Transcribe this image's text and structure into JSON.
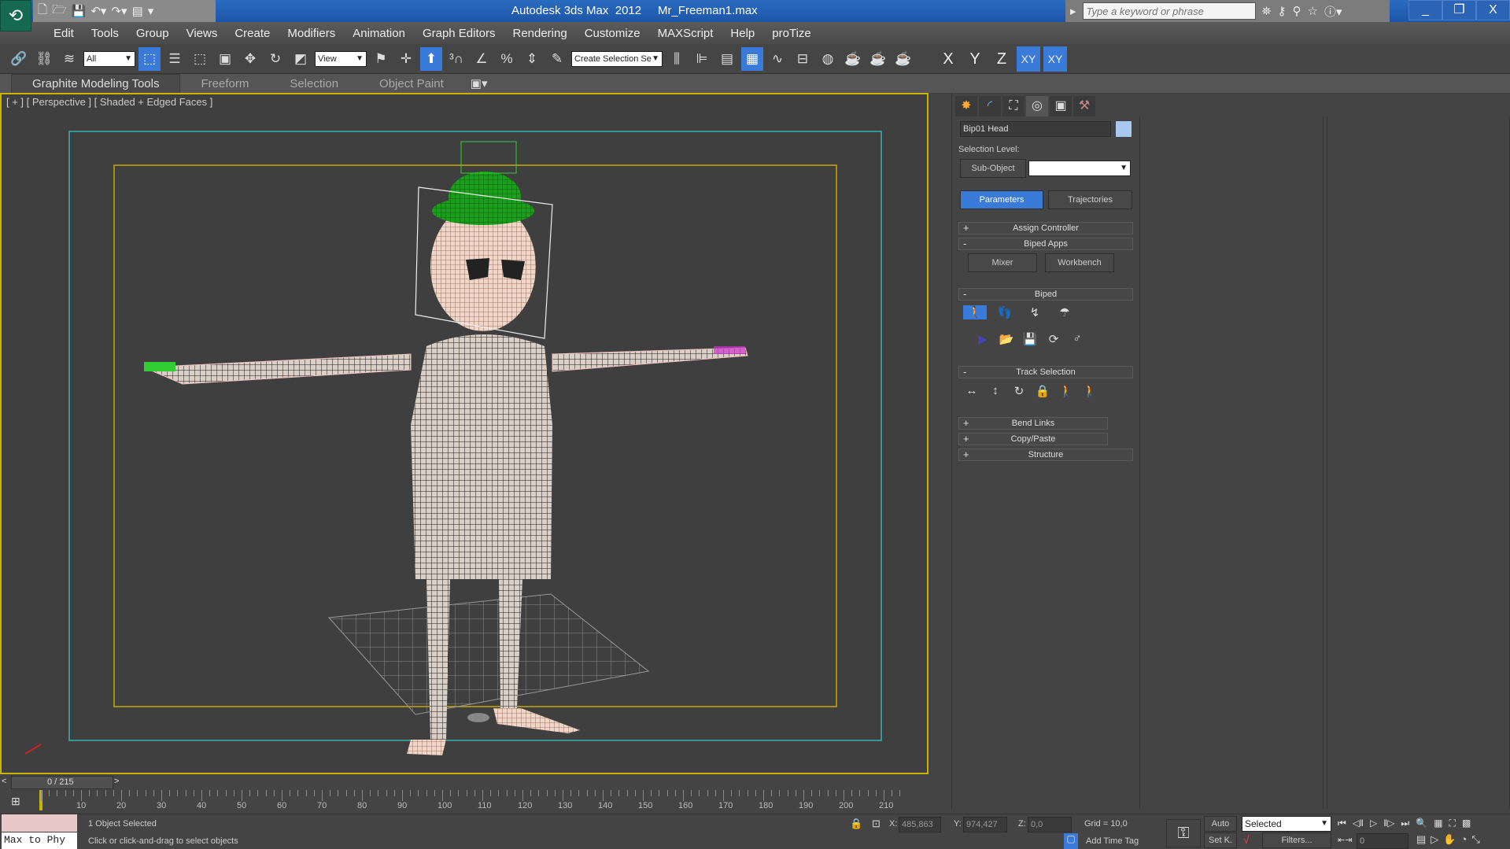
{
  "titlebar": {
    "app": "Autodesk 3ds Max  2012",
    "file": "Mr_Freeman1.max",
    "search_placeholder": "Type a keyword or phrase",
    "qat_icons": [
      "new-file-icon",
      "open-file-icon",
      "save-icon",
      "undo-icon",
      "redo-icon",
      "project-folder-icon",
      "customize-dropdown-icon"
    ],
    "search_icons": [
      "binoculars-icon",
      "key-icon",
      "satellite-icon",
      "star-icon",
      "help-icon"
    ]
  },
  "menu": [
    "Edit",
    "Tools",
    "Group",
    "Views",
    "Create",
    "Modifiers",
    "Animation",
    "Graph Editors",
    "Rendering",
    "Customize",
    "MAXScript",
    "Help",
    "proTize"
  ],
  "toolbar": {
    "filter": "All",
    "refcoord": "View",
    "selset": "Create Selection Se",
    "axes": [
      "X",
      "Y",
      "Z",
      "XY",
      "XY"
    ]
  },
  "ribbon": {
    "tabs": [
      "Graphite Modeling Tools",
      "Freeform",
      "Selection",
      "Object Paint"
    ]
  },
  "viewport": {
    "label": "[ + ] [ Perspective ] [ Shaded + Edged Faces ]"
  },
  "cmdpanel": {
    "object_name": "Bip01 Head",
    "object_color": "#a8c8f0",
    "selection_level_label": "Selection Level:",
    "sub_object": "Sub-Object",
    "tabs": [
      "Parameters",
      "Trajectories"
    ],
    "rollouts": {
      "assign_controller": "Assign Controller",
      "biped_apps": "Biped Apps",
      "mixer": "Mixer",
      "workbench": "Workbench",
      "biped": "Biped",
      "track_selection": "Track Selection",
      "bend_links": "Bend Links",
      "copy_paste": "Copy/Paste",
      "structure": "Structure"
    }
  },
  "timeline": {
    "frame": "0 / 215",
    "ticks": [
      "10",
      "20",
      "30",
      "40",
      "50",
      "60",
      "70",
      "80",
      "90",
      "100",
      "110",
      "120",
      "130",
      "140",
      "150",
      "160",
      "170",
      "180",
      "190",
      "200",
      "210"
    ]
  },
  "status": {
    "maxscript": "Max to Phy",
    "selected": "1 Object Selected",
    "prompt": "Click or click-and-drag to select objects",
    "x_label": "X:",
    "x": "485,863",
    "y_label": "Y:",
    "y": "974,427",
    "z_label": "Z:",
    "z": "0,0",
    "grid": "Grid = 10,0",
    "add_time_tag": "Add Time Tag",
    "auto": "Auto",
    "setk": "Set K.",
    "key_filter": "Selected",
    "filters": "Filters...",
    "current_frame": "0"
  }
}
